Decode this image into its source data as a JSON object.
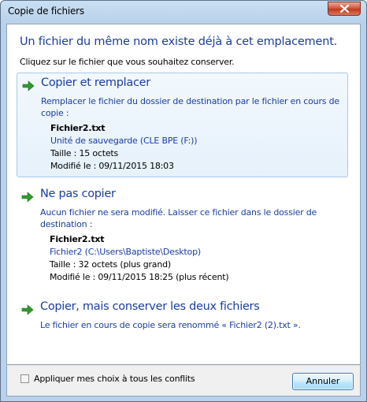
{
  "window": {
    "title": "Copie de fichiers"
  },
  "header": {
    "main_instruction": "Un fichier du même nom existe déjà à cet emplacement.",
    "sub_instruction": "Cliquez sur le fichier que vous souhaitez conserver."
  },
  "options": [
    {
      "title": "Copier et remplacer",
      "description": "Remplacer le fichier du dossier de destination par le fichier en cours de copie :",
      "file": {
        "name": "Fichier2.txt",
        "location": "Unité de sauvegarde (CLE BPE (F:))",
        "size": "Taille : 15 octets",
        "modified": "Modifié le : 09/11/2015 18:03"
      }
    },
    {
      "title": "Ne pas copier",
      "description": "Aucun fichier ne sera modifié. Laisser ce fichier dans le dossier de destination :",
      "file": {
        "name": "Fichier2.txt",
        "location": "Fichier2 (C:\\Users\\Baptiste\\Desktop)",
        "size": "Taille : 32 octets (plus grand)",
        "modified": "Modifié le : 09/11/2015 18:25 (plus récent)"
      }
    },
    {
      "title": "Copier, mais conserver les deux fichiers",
      "description": "Le fichier en cours de copie sera renommé « Fichier2 (2).txt »."
    }
  ],
  "footer": {
    "apply_all_label": "Appliquer mes choix à tous les conflits",
    "apply_all_checked": false,
    "cancel_label": "Annuler"
  },
  "colors": {
    "accent_text": "#1a3e9e",
    "arrow_green": "#2f9a2a",
    "selected_border": "#a9c9e6"
  },
  "icons": {
    "option_arrow": "green-arrow-icon",
    "close": "close-icon"
  }
}
